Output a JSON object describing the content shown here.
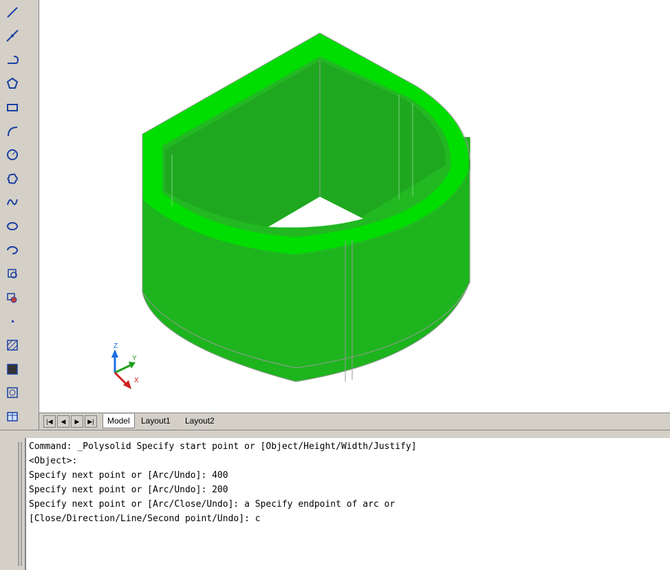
{
  "toolbar": {
    "tools": [
      {
        "name": "line-icon"
      },
      {
        "name": "construction-line-icon"
      },
      {
        "name": "polyline-icon"
      },
      {
        "name": "polygon-icon"
      },
      {
        "name": "rectangle-icon"
      },
      {
        "name": "arc-icon"
      },
      {
        "name": "circle-icon"
      },
      {
        "name": "revision-cloud-icon"
      },
      {
        "name": "spline-icon"
      },
      {
        "name": "ellipse-icon"
      },
      {
        "name": "ellipse-arc-icon"
      },
      {
        "name": "insert-block-icon"
      },
      {
        "name": "make-block-icon"
      },
      {
        "name": "point-icon"
      },
      {
        "name": "hatch-icon"
      },
      {
        "name": "gradient-icon"
      },
      {
        "name": "region-icon"
      },
      {
        "name": "table-icon"
      }
    ]
  },
  "ucs": {
    "z": "Z",
    "y": "Y",
    "x": "X"
  },
  "tabs": {
    "model": "Model",
    "layout1": "Layout1",
    "layout2": "Layout2"
  },
  "command": {
    "lines": [
      "Command: _Polysolid Specify start point or [Object/Height/Width/Justify]",
      "<Object>:",
      "Specify next point or [Arc/Undo]: 400",
      "Specify next point or [Arc/Undo]: 200",
      "Specify next point or [Arc/Close/Undo]: a Specify endpoint of arc or",
      "[Close/Direction/Line/Second point/Undo]: c"
    ]
  },
  "colors": {
    "solid": "#22b822",
    "solid_top": "#00dd00"
  }
}
